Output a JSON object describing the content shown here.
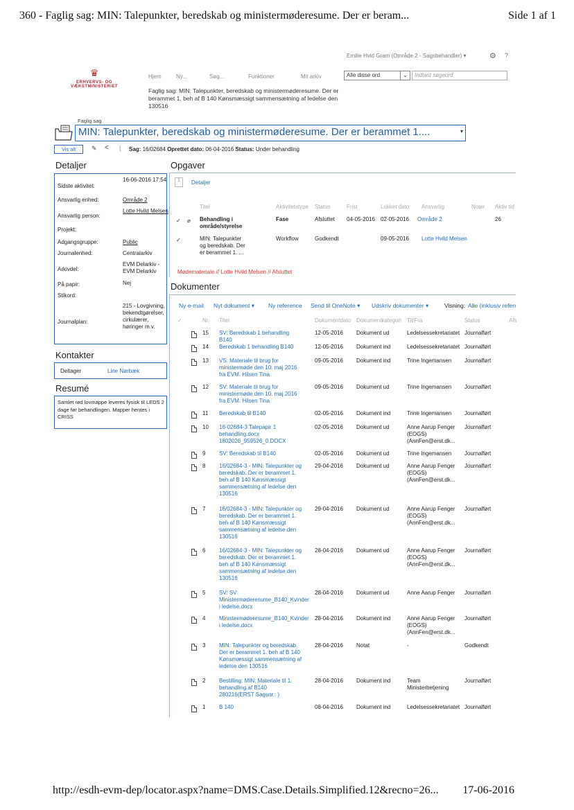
{
  "print": {
    "header": "360 - Faglig sag: MIN: Talepunkter, beredskab og ministermøderesume. Der er beram...",
    "page": "Side 1 af 1",
    "footer_url": "http://esdh-evm-dep/locator.aspx?name=DMS.Case.Details.Simplified.12&recno=26...",
    "footer_date": "17-06-2016"
  },
  "topbar": {
    "user": "Emilie Hvid Gram (Område 2 - Sagsbehandler) ▾",
    "nav": [
      "Hjem",
      "Ny...",
      "Søg...",
      "Funktioner",
      "Mit arkiv"
    ],
    "search_scope": "Alle disse ord",
    "search_placeholder": "Indtast søgeord",
    "logo_text": "ERHVERVS- OG VÆKSTMINISTERIET",
    "crumb": "Faglig sag: MIN: Talepunkter, beredskab og ministermøderesume. Der er berammet 1. beh af B 140 Kønsmæssigt sammensætning af ledelse den 130516"
  },
  "case": {
    "type_label": "Faglig sag",
    "title": "MIN: Talepunkter, beredskab og ministermøderesume. Der er berammet 1....",
    "show_all": "Vis alt",
    "sag_label": "Sag:",
    "sag": "16/02684",
    "created_label": "Oprettet dato:",
    "created": "06-04-2016",
    "status_label": "Status:",
    "status": "Under behandling"
  },
  "details": {
    "heading": "Detaljer",
    "rows": [
      {
        "k": "Sidste aktivitet:",
        "v": "16-06-2016 17:54"
      },
      {
        "k": "Ansvarlig enhed:",
        "v": "Område 2"
      },
      {
        "k": "Ansvarlig person:",
        "v": "Lotte Hvild Melsen"
      },
      {
        "k": "Projekt:",
        "v": ""
      },
      {
        "k": "Adgangsgruppe:",
        "v": "Public"
      },
      {
        "k": "Journalenhed:",
        "v": "Centralarkiv"
      },
      {
        "k": "Arkivdel:",
        "v": "EVM Delarkiv - EVM Delarkiv"
      },
      {
        "k": "På papir:",
        "v": "Nej"
      },
      {
        "k": "Stikord:",
        "v": ""
      },
      {
        "k": "Journalplan:",
        "v": "215 - Lovgivning, bekendtgørelser, cirkulærer, høringer m.v."
      }
    ]
  },
  "contacts": {
    "heading": "Kontakter",
    "role": "Deltager",
    "name": "Line Nørbæk"
  },
  "resume": {
    "heading": "Resumé",
    "text": "Samlet rød lovmappe leveres fysisk til LEDS 2 dage før behandlingen. Mapper hentes i CRISS"
  },
  "tasks": {
    "heading": "Opgaver",
    "tab": "Detaljer",
    "columns": [
      "Titel",
      "Aktivitetstype",
      "Status",
      "Frist",
      "Lukket dato",
      "Ansvarlig",
      "Noter",
      "Aktiv tid"
    ],
    "rows": [
      {
        "title": "Behandling i område/styrelse",
        "type": "Fase",
        "status": "Afsluttet",
        "deadline": "04-05-2016",
        "closed": "02-05-2016",
        "owner": "Område 2",
        "active": "26"
      },
      {
        "title": "MIN: Talepunkter og beredskab. Der er berammet 1. ...",
        "type": "Workflow",
        "status": "Godkendt",
        "deadline": "",
        "closed": "09-05-2016",
        "owner": "Lotte Hvild Melsen",
        "active": ""
      }
    ],
    "footnote": "Mødemateriale // Lotte Hvild Melsen // Afsluttet"
  },
  "documents": {
    "heading": "Dokumenter",
    "toolbar": [
      "Ny e-mail",
      "Nyt dokument ▾",
      "Ny reference",
      "Send til OneNote ▾",
      "Udskriv dokumenter ▾"
    ],
    "view_label": "Visning:",
    "view_value": "Alle (inklusiv referer",
    "columns": [
      "Nr.",
      "Titel",
      "Dokumentdato",
      "Dokumentkategori",
      "Til/Fra",
      "Status",
      "Afs"
    ],
    "rows": [
      {
        "nr": "15",
        "title": "SV: Beredskab 1 behandling B140",
        "date": "12-05-2016",
        "cat": "Dokument ud",
        "party": "Ledelsessekretariatet",
        "status": "Journalført"
      },
      {
        "nr": "14",
        "title": "Beredskab 1 behandling B140",
        "date": "12-05-2016",
        "cat": "Dokument ind",
        "party": "Ledelsessekretariatet",
        "status": "Journalført"
      },
      {
        "nr": "13",
        "title": "VS: Materiale til brug for ministermøde den 10. maj 2016 fra EVM. Hilsen Tina",
        "date": "09-05-2016",
        "cat": "Dokument ind",
        "party": "Trine Ingemansen",
        "status": "Journalført"
      },
      {
        "nr": "12",
        "title": "SV: Materiale til brug for ministermøde den 10. maj 2016 fra EVM. Hilsen Tina",
        "date": "09-05-2016",
        "cat": "Dokument ud",
        "party": "Trine Ingemansen",
        "status": "Journalført"
      },
      {
        "nr": "11",
        "title": "Beredskab til B140",
        "date": "02-05-2016",
        "cat": "Dokument ind",
        "party": "Trine Ingemansen",
        "status": "Journalført"
      },
      {
        "nr": "10",
        "title": "16-02684-3 Talepapir 1 behandling.docx 1802026_959526_0.DOCX",
        "date": "02-05-2016",
        "cat": "Dokument ud",
        "party": "Anne Aarup Fenger (EOGS) (AnnFen@erst.dk...",
        "status": "Journalført"
      },
      {
        "nr": "9",
        "title": "SV: Beredskab til B140",
        "date": "02-05-2016",
        "cat": "Dokument ud",
        "party": "Trine Ingemansen",
        "status": "Journalført"
      },
      {
        "nr": "8",
        "title": "16/02684-3 - MIN: Talepunkter og beredskab. Der er berammet 1. beh af B 140 Kønsmæssigt sammensætning af ledelse den 130516",
        "date": "29-04-2016",
        "cat": "Dokument ud",
        "party": "Anne Aarup Fenger (EOGS) (AnnFen@erst.dk...",
        "status": "Journalført"
      },
      {
        "nr": "7",
        "title": "16/02684-3 - MIN: Talepunkter og beredskab. Der er berammet 1. beh af B 140 Kønsmæssigt sammensætning af ledelse den 130516",
        "date": "29-04-2016",
        "cat": "Dokument ud",
        "party": "Anne Aarup Fenger (EOGS) (AnnFen@erst.dk...",
        "status": "Journalført"
      },
      {
        "nr": "6",
        "title": "16/02684-3 - MIN: Talepunkter og beredskab. Der er berammet 1. beh af B 140 Kønsmæssigt sammensætning af ledelse den 130516",
        "date": "28-04-2016",
        "cat": "Dokument ud",
        "party": "Anne Aarup Fenger (EOGS) (AnnFen@erst.dk...",
        "status": "Journalført"
      },
      {
        "nr": "5",
        "title": "SV: SV: Ministermøderesume_B140_Kvinder i ledelse.docx",
        "date": "28-04-2016",
        "cat": "Dokument ud",
        "party": "Anne Aarup Fenger",
        "status": "Journalført"
      },
      {
        "nr": "4",
        "title": "Ministermøderesume_B140_Kvinder i ledelse.docx",
        "date": "28-04-2016",
        "cat": "Dokument ind",
        "party": "Anne Aarup Fenger (EOGS) (AnnFen@erst.dk...",
        "status": "Journalført"
      },
      {
        "nr": "3",
        "title": "MIN: Talepunkter og beredskab. Der er berammet 1. beh af B 140 Kønsmæssigt sammensætning af ledelse den 130516",
        "date": "28-04-2016",
        "cat": "Notat",
        "party": "-",
        "status": "Godkendt"
      },
      {
        "nr": "2",
        "title": "Bestilling: MIN: Materiale til 1. behandling af B140 280216(ERST Sagsnr.: )",
        "date": "28-04-2016",
        "cat": "Dokument ind",
        "party": "Team Ministerbetjening",
        "status": "Journalført"
      },
      {
        "nr": "1",
        "title": "B 140",
        "date": "08-04-2016",
        "cat": "Dokument ind",
        "party": "Ledelsessekretariatet",
        "status": "Journalført"
      }
    ]
  }
}
